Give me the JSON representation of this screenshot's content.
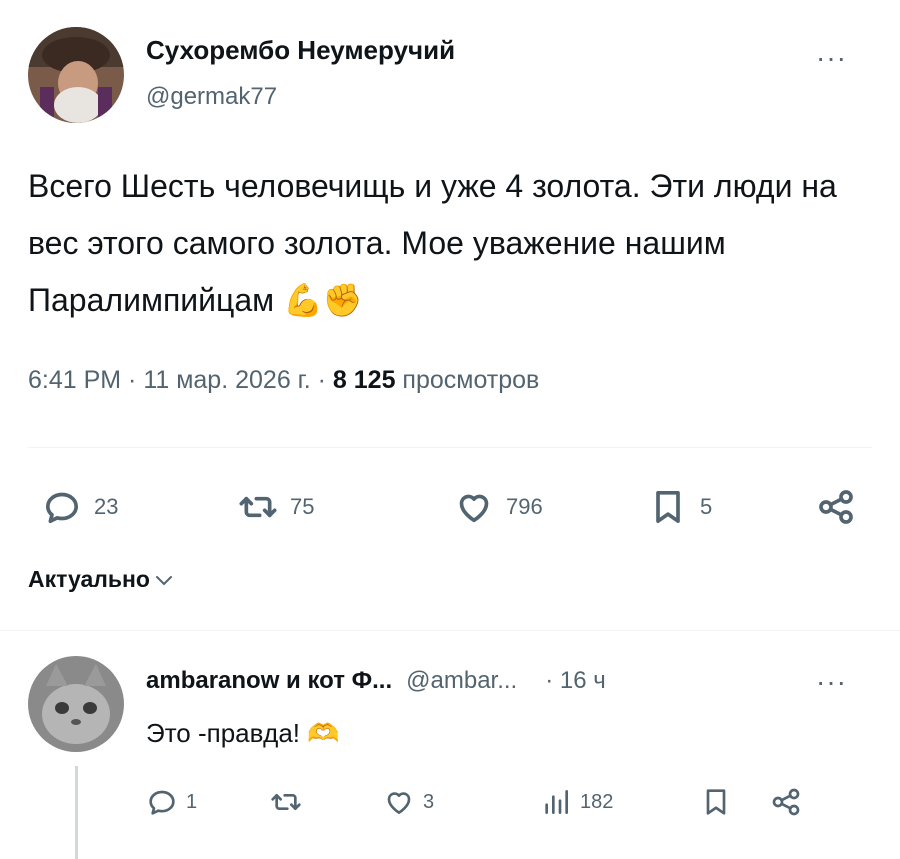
{
  "tweet": {
    "author_name": "Сухорембо Неумеручий",
    "author_handle": "@germak77",
    "more_label": "···",
    "text": "Всего Шесть человечищь и уже 4 золота. Эти люди на вес этого самого золота. Мое уважение нашим Паралимпийцам 💪✊",
    "time": "6:41 PM · 11 мар. 2026 г. · ",
    "views_count": "8 125",
    "views_label": " просмотров",
    "actions": {
      "replies": "23",
      "retweets": "75",
      "likes": "796",
      "bookmarks": "5"
    }
  },
  "sort": {
    "label": "Актуально",
    "chevron": "⌄"
  },
  "reply": {
    "author_name": "ambaranow и кот Ф...",
    "author_handle": "@ambar...",
    "time": "· 16 ч",
    "more_label": "···",
    "text": "Это -правда! 🫶",
    "actions": {
      "replies": "1",
      "retweets": "",
      "likes": "3",
      "views": "182",
      "bookmarks": ""
    }
  },
  "colors": {
    "text_primary": "#0f1419",
    "text_secondary": "#536471",
    "divider": "#eff3f4",
    "emoji_yellow": "#f7c84a"
  },
  "icons": [
    "reply-icon",
    "retweet-icon",
    "like-icon",
    "bookmark-icon",
    "share-icon",
    "views-icon",
    "more-icon",
    "chevron-down-icon"
  ]
}
